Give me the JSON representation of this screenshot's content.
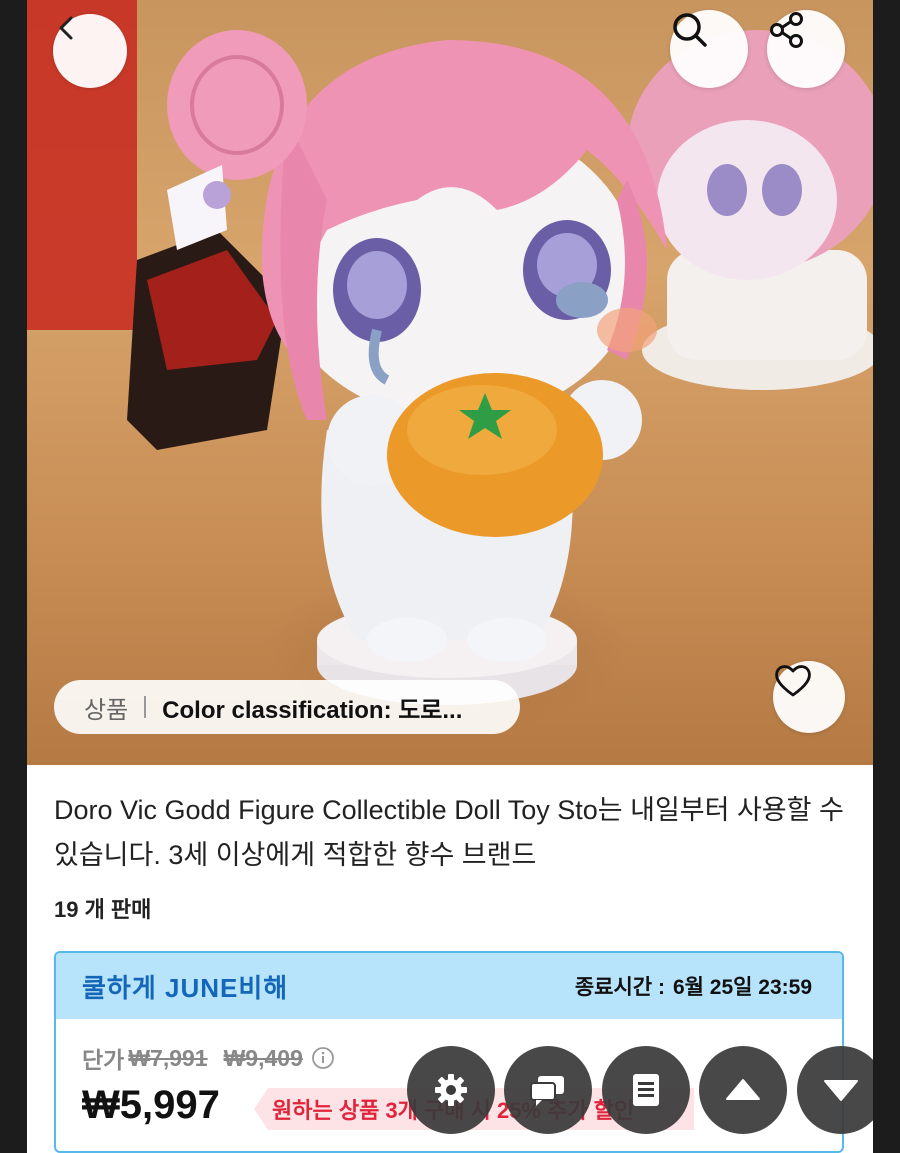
{
  "product": {
    "variant_tag": "상품",
    "variant_value": "Color classification: 도로...",
    "title": "Doro Vic Godd Figure Collectible Doll Toy Sto는 내일부터 사용할 수 있습니다. 3세 이상에게 적합한 향수 브랜드",
    "sold_count": "19 개 판매"
  },
  "promo": {
    "title": "쿨하게 JUNE비해",
    "end_label": "종료시간 :",
    "end_time": "6월 25일 23:59",
    "unit_label": "단가",
    "unit_price": "₩7,991",
    "original_price": "₩9,409",
    "sale_price": "₩5,997",
    "discount_text": "원하는 상품 3개 구매 시 25% 추가 할인"
  },
  "icons": {
    "back": "chevron-left-icon",
    "search": "search-icon",
    "share": "share-icon",
    "wishlist": "heart-icon",
    "info": "info-icon",
    "settings": "gear-icon",
    "chat": "chat-icon",
    "document": "document-icon",
    "scroll_up": "triangle-up-icon",
    "scroll_down": "triangle-down-icon"
  },
  "colors": {
    "promo_border": "#56b9ea",
    "promo_header_bg": "#b7e3fb",
    "promo_title": "#1467b8",
    "discount_text": "#e0253b",
    "discount_bg": "#fde3e6"
  }
}
